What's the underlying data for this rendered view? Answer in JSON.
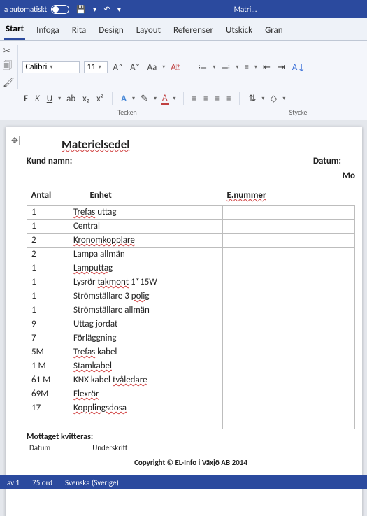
{
  "titlebar": {
    "autosave_label": "a automatiskt",
    "doc_name": "Matri..."
  },
  "tabs": [
    "Start",
    "Infoga",
    "Rita",
    "Design",
    "Layout",
    "Referenser",
    "Utskick",
    "Gran"
  ],
  "active_tab": "Start",
  "ribbon": {
    "font_name": "Calibri",
    "font_size": "11",
    "group_font": "Tecken",
    "group_para": "Stycke",
    "bold": "F",
    "italic": "K",
    "underline": "U",
    "strike": "ab",
    "sub": "x₂",
    "sup": "x²",
    "aplus": "A˄",
    "aminus": "A˅",
    "aa": "Aa",
    "clearfmt": "A⃠",
    "textfx": "A",
    "highlight": "✎",
    "fontcolor": "A"
  },
  "doc": {
    "title": "Materielsedel",
    "kund_label": "Kund namn:",
    "datum_label": "Datum:",
    "right_cut": "Mo",
    "col_antal": "Antal",
    "col_enhet": "Enhet",
    "col_enummer": "E.nummer",
    "rows": [
      {
        "antal": "1",
        "enhet": "Trefas uttag"
      },
      {
        "antal": "1",
        "enhet": "Central"
      },
      {
        "antal": "2",
        "enhet": "Kronomkopplare"
      },
      {
        "antal": "2",
        "enhet": "Lampa allmän"
      },
      {
        "antal": "1",
        "enhet": "Lamputtag"
      },
      {
        "antal": "1",
        "enhet": "Lysrör takmont 1*15W"
      },
      {
        "antal": "1",
        "enhet": "Strömställare 3 polig"
      },
      {
        "antal": "1",
        "enhet": "Strömställare allmän"
      },
      {
        "antal": "9",
        "enhet": "Uttag jordat"
      },
      {
        "antal": "7",
        "enhet": "Förläggning"
      },
      {
        "antal": "5M",
        "enhet": "Trefas kabel"
      },
      {
        "antal": "1 M",
        "enhet": "Stamkabel"
      },
      {
        "antal": "61 M",
        "enhet": "KNX kabel tvåledare"
      },
      {
        "antal": "69M",
        "enhet": "Flexrör"
      },
      {
        "antal": "17",
        "enhet": "Kopplingsdosa"
      }
    ],
    "mottaget_label": "Mottaget kvitteras:",
    "sig_datum": "Datum",
    "sig_under": "Underskrift",
    "copyright": "Copyright © EL-Info i Växjö AB 2014"
  },
  "status": {
    "page": "av 1",
    "words": "75 ord",
    "lang": "Svenska (Sverige)"
  }
}
